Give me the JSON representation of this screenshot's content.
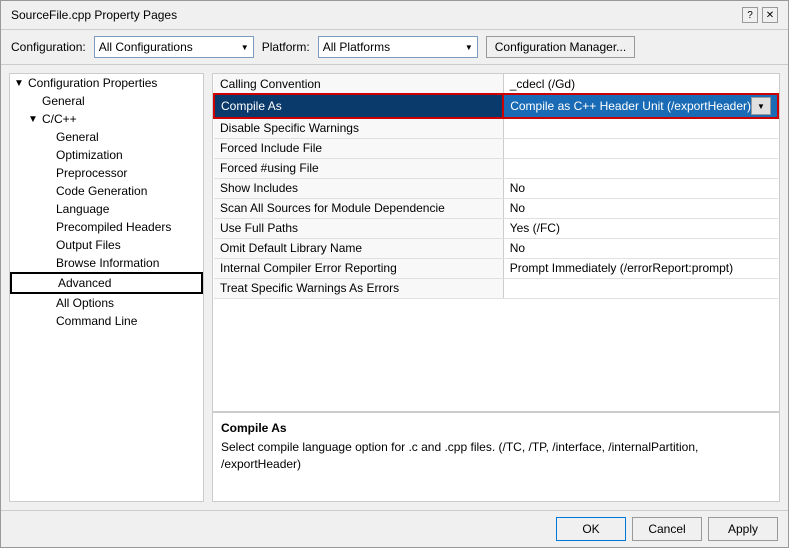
{
  "dialog": {
    "title": "SourceFile.cpp Property Pages",
    "help_icon": "?",
    "close_icon": "✕"
  },
  "toolbar": {
    "config_label": "Configuration:",
    "config_value": "All Configurations",
    "platform_label": "Platform:",
    "platform_value": "All Platforms",
    "config_mgr_label": "Configuration Manager..."
  },
  "sidebar": {
    "items": [
      {
        "id": "config-props",
        "label": "Configuration Properties",
        "level": 1,
        "expand": "▼",
        "selected": false
      },
      {
        "id": "general",
        "label": "General",
        "level": 2,
        "expand": "",
        "selected": false
      },
      {
        "id": "cpp",
        "label": "C/C++",
        "level": 2,
        "expand": "▼",
        "selected": false
      },
      {
        "id": "cpp-general",
        "label": "General",
        "level": 3,
        "expand": "",
        "selected": false
      },
      {
        "id": "optimization",
        "label": "Optimization",
        "level": 3,
        "expand": "",
        "selected": false
      },
      {
        "id": "preprocessor",
        "label": "Preprocessor",
        "level": 3,
        "expand": "",
        "selected": false
      },
      {
        "id": "code-gen",
        "label": "Code Generation",
        "level": 3,
        "expand": "",
        "selected": false
      },
      {
        "id": "language",
        "label": "Language",
        "level": 3,
        "expand": "",
        "selected": false
      },
      {
        "id": "precompiled",
        "label": "Precompiled Headers",
        "level": 3,
        "expand": "",
        "selected": false
      },
      {
        "id": "output-files",
        "label": "Output Files",
        "level": 3,
        "expand": "",
        "selected": false
      },
      {
        "id": "browse-info",
        "label": "Browse Information",
        "level": 3,
        "expand": "",
        "selected": false
      },
      {
        "id": "advanced",
        "label": "Advanced",
        "level": 3,
        "expand": "",
        "selected": true
      },
      {
        "id": "all-options",
        "label": "All Options",
        "level": 3,
        "expand": "",
        "selected": false
      },
      {
        "id": "command-line",
        "label": "Command Line",
        "level": 3,
        "expand": "",
        "selected": false
      }
    ]
  },
  "properties": {
    "rows": [
      {
        "id": "calling-conv",
        "name": "Calling Convention",
        "value": "_cdecl (/Gd)",
        "selected": false
      },
      {
        "id": "compile-as",
        "name": "Compile As",
        "value": "Compile as C++ Header Unit (/exportHeader)",
        "selected": true,
        "has_dropdown": true
      },
      {
        "id": "disable-warnings",
        "name": "Disable Specific Warnings",
        "value": "",
        "selected": false
      },
      {
        "id": "forced-include",
        "name": "Forced Include File",
        "value": "",
        "selected": false
      },
      {
        "id": "forced-using",
        "name": "Forced #using File",
        "value": "",
        "selected": false
      },
      {
        "id": "show-includes",
        "name": "Show Includes",
        "value": "No",
        "selected": false
      },
      {
        "id": "scan-sources",
        "name": "Scan All Sources for Module Dependencie",
        "value": "No",
        "selected": false
      },
      {
        "id": "full-paths",
        "name": "Use Full Paths",
        "value": "Yes (/FC)",
        "selected": false
      },
      {
        "id": "omit-default",
        "name": "Omit Default Library Name",
        "value": "No",
        "selected": false
      },
      {
        "id": "internal-error",
        "name": "Internal Compiler Error Reporting",
        "value": "Prompt Immediately (/errorReport:prompt)",
        "selected": false
      },
      {
        "id": "treat-warnings",
        "name": "Treat Specific Warnings As Errors",
        "value": "",
        "selected": false
      }
    ]
  },
  "info": {
    "title": "Compile As",
    "description": "Select compile language option for .c and .cpp files.   (/TC, /TP, /interface, /internalPartition, /exportHeader)"
  },
  "footer": {
    "ok_label": "OK",
    "cancel_label": "Cancel",
    "apply_label": "Apply"
  }
}
